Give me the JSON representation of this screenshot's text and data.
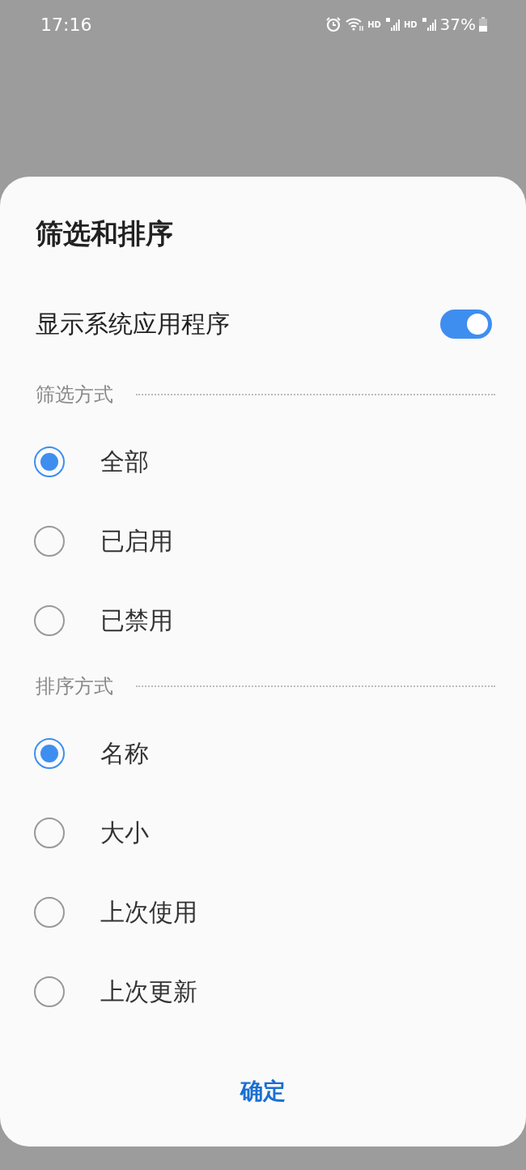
{
  "status_bar": {
    "time": "17:16",
    "network_1": "HD",
    "network_2": "HD",
    "battery": "37%"
  },
  "sheet": {
    "title": "筛选和排序",
    "toggle": {
      "label": "显示系统应用程序",
      "on": true
    },
    "sections": [
      {
        "header": "筛选方式",
        "options": [
          {
            "label": "全部",
            "selected": true
          },
          {
            "label": "已启用",
            "selected": false
          },
          {
            "label": "已禁用",
            "selected": false
          }
        ]
      },
      {
        "header": "排序方式",
        "options": [
          {
            "label": "名称",
            "selected": true
          },
          {
            "label": "大小",
            "selected": false
          },
          {
            "label": "上次使用",
            "selected": false
          },
          {
            "label": "上次更新",
            "selected": false
          }
        ]
      }
    ],
    "confirm_button": "确定"
  }
}
